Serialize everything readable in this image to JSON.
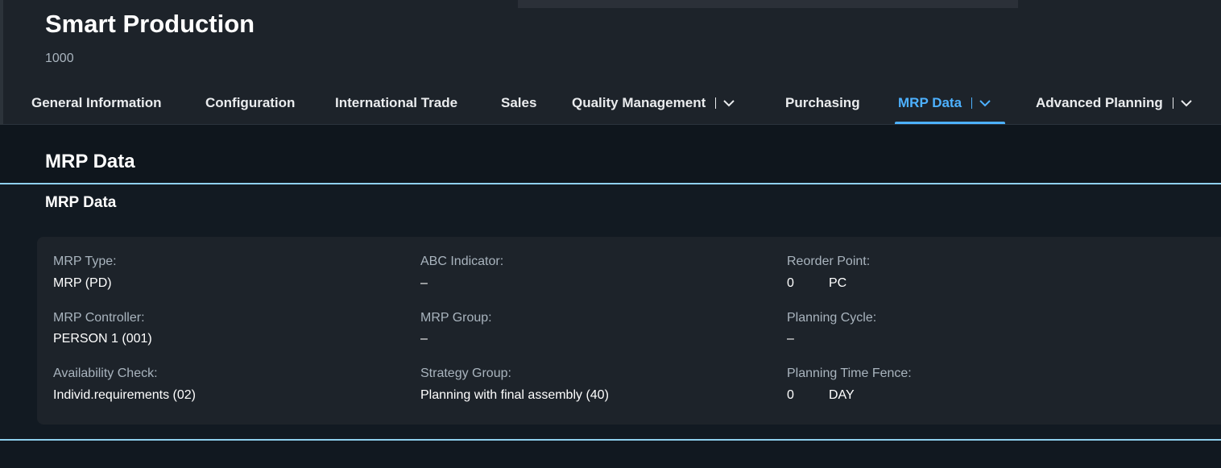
{
  "app": {
    "title": "Smart Production",
    "subtitle": "1000"
  },
  "tabs": [
    {
      "label": "General Information"
    },
    {
      "label": "Configuration"
    },
    {
      "label": "International Trade"
    },
    {
      "label": "Sales"
    },
    {
      "label": "Quality Management",
      "icon": "chevron-down-icon"
    },
    {
      "label": "Purchasing"
    },
    {
      "label": "MRP Data",
      "icon": "chevron-down-icon",
      "active": true
    },
    {
      "label": "Advanced Planning",
      "icon": "chevron-down-icon"
    }
  ],
  "section": {
    "title": "MRP Data",
    "subtitle": "MRP Data"
  },
  "fields": {
    "mrp_type": {
      "label": "MRP Type:",
      "value": "MRP (PD)"
    },
    "mrp_controller": {
      "label": "MRP Controller:",
      "value": "PERSON 1 (001)"
    },
    "availability_check": {
      "label": "Availability Check:",
      "value": "Individ.requirements (02)"
    },
    "abc_indicator": {
      "label": "ABC Indicator:",
      "value": "–"
    },
    "mrp_group": {
      "label": "MRP Group:",
      "value": "–"
    },
    "strategy_group": {
      "label": "Strategy Group:",
      "value": "Planning with final assembly (40)"
    },
    "reorder_point": {
      "label": "Reorder Point:",
      "value": "0",
      "unit": "PC"
    },
    "planning_cycle": {
      "label": "Planning Cycle:",
      "value": "–"
    },
    "planning_time_fence": {
      "label": "Planning Time Fence:",
      "value": "0",
      "unit": "DAY"
    }
  },
  "colors": {
    "accent": "#4db1ff",
    "header_bg": "#1d232a",
    "page_bg": "#0f161d",
    "section_line": "#8fd0ee"
  }
}
